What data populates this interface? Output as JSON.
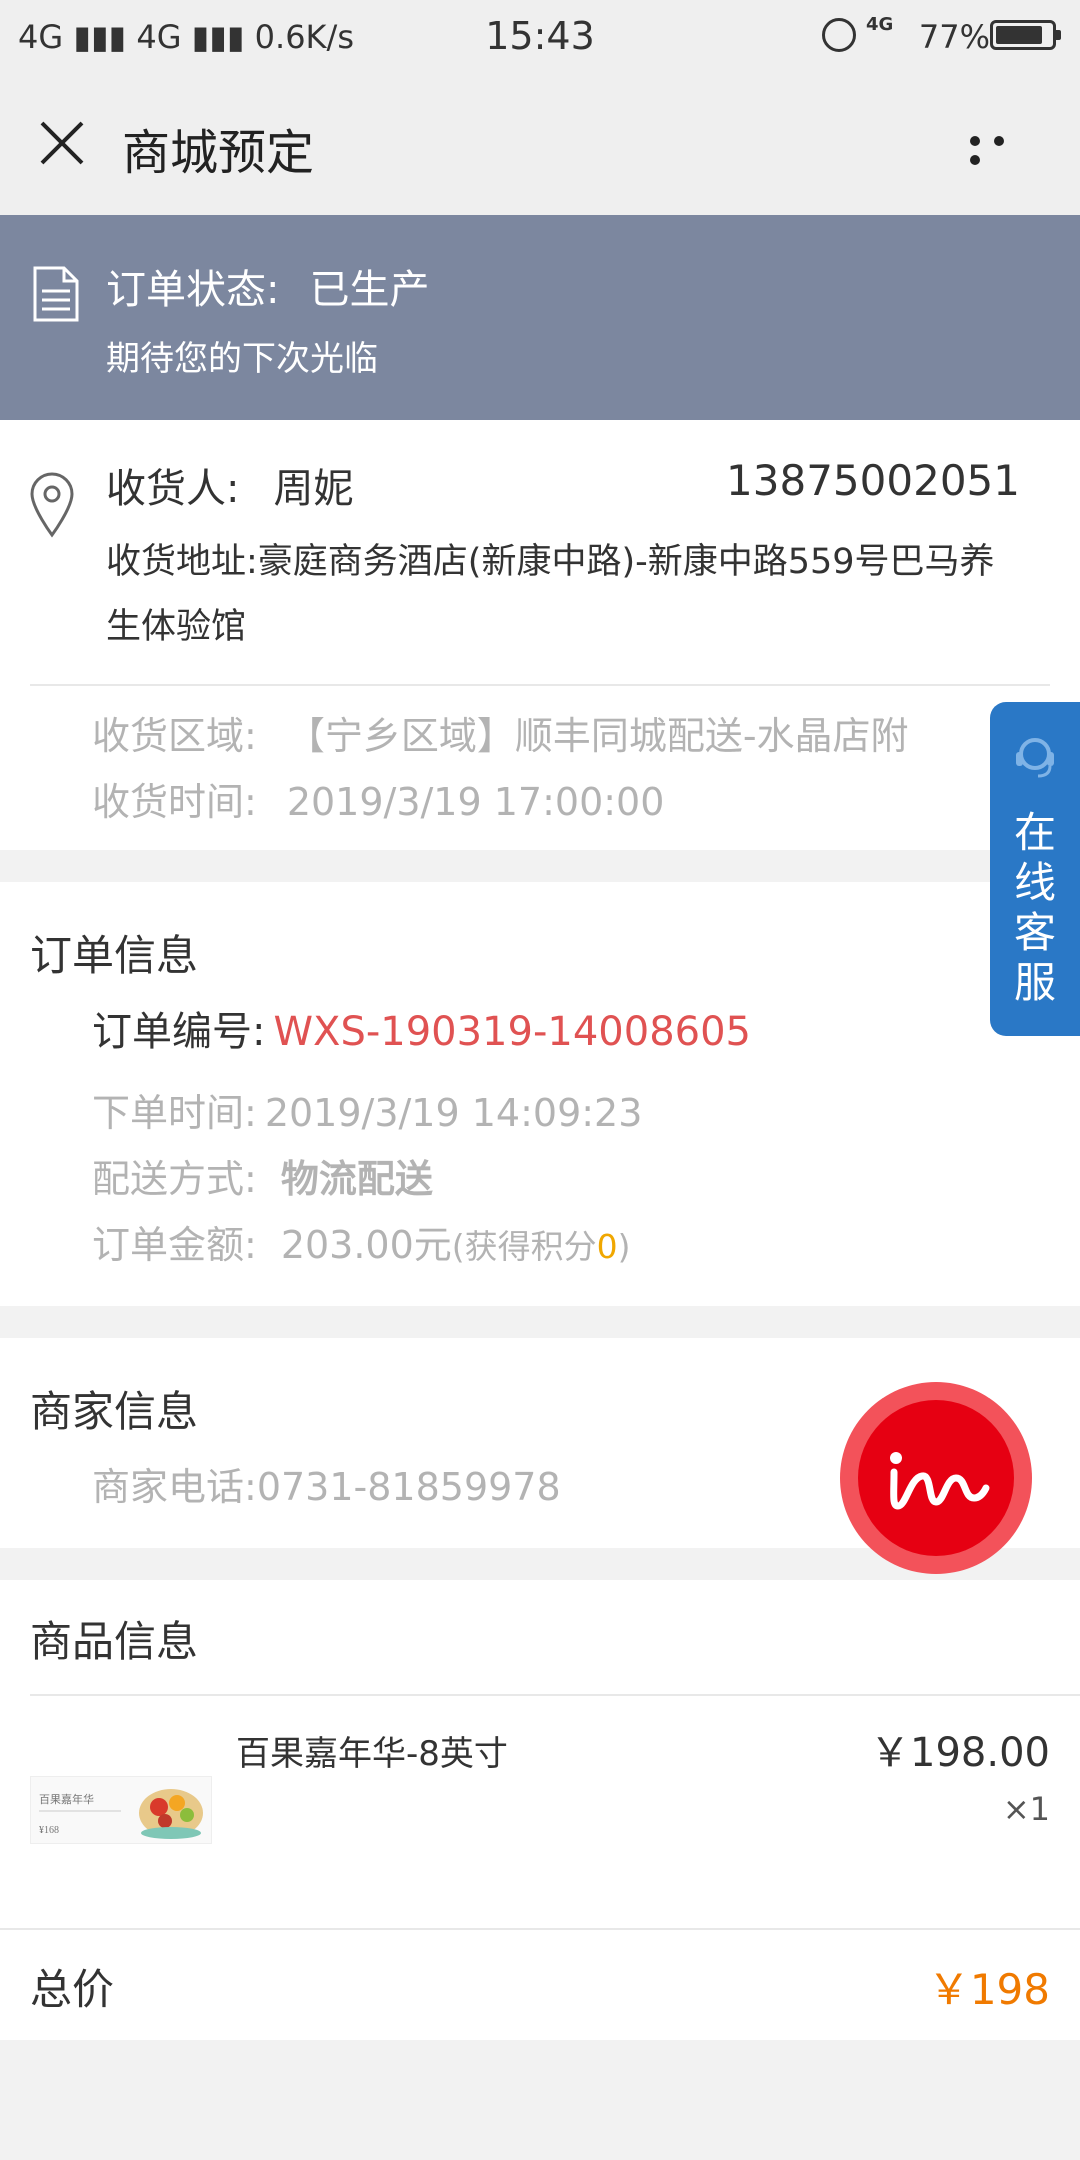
{
  "status_bar": {
    "signal_left": "4G",
    "signal_right": "4G",
    "speed": "0.6K/s",
    "time": "15:43",
    "network_badge": "4G",
    "battery": "77%"
  },
  "navbar": {
    "title": "商城预定"
  },
  "order_status": {
    "label": "订单状态:",
    "value": "已生产",
    "subtitle": "期待您的下次光临"
  },
  "address": {
    "receiver_label": "收货人:",
    "receiver_name": "周妮",
    "phone": "13875002051",
    "address_label": "收货地址:",
    "address_value": "豪庭商务酒店(新康中路)-新康中路559号巴马养生体验馆",
    "region_label": "收货区域:",
    "region_value": "【宁乡区域】顺丰同城配送-水晶店附",
    "time_label": "收货时间:",
    "time_value": "2019/3/19 17:00:00"
  },
  "order_info": {
    "title": "订单信息",
    "number_label": "订单编号:",
    "number_value": "WXS-190319-14008605",
    "time_label": "下单时间:",
    "time_value": "2019/3/19 14:09:23",
    "ship_label": "配送方式:",
    "ship_value": "物流配送",
    "amount_label": "订单金额:",
    "amount_value": "203.00元",
    "points_prefix": "(获得积分",
    "points_value": "0",
    "points_suffix": ")"
  },
  "merchant": {
    "title": "商家信息",
    "phone_label": "商家电话:",
    "phone_value": "0731-81859978"
  },
  "goods": {
    "title": "商品信息",
    "item_name": "百果嘉年华-8英寸",
    "item_price": "￥198.00",
    "item_qty": "×1",
    "thumb_text": "百果嘉年华",
    "thumb_price": "¥168",
    "total_label": "总价",
    "total_value": "￥198"
  },
  "service_tab": {
    "label": "在线客服"
  },
  "colors": {
    "banner": "#7c879f",
    "order_number": "#e05252",
    "points": "#f0a700",
    "total": "#f07a00",
    "service_tab": "#2a78c6",
    "im_button": "#e60012"
  }
}
